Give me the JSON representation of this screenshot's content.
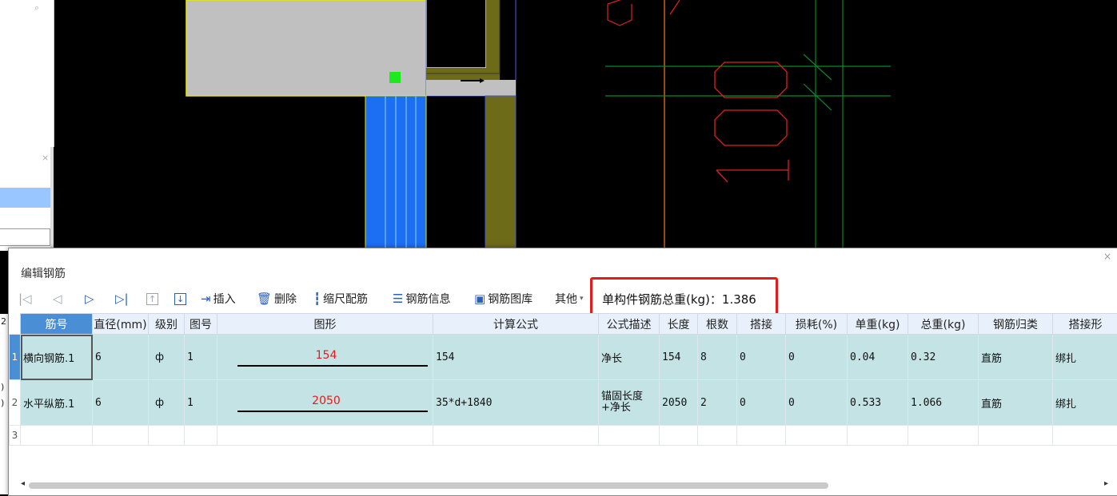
{
  "side": {
    "rowmark_1": "2",
    "rowmark_2": ")",
    "rowmark_3": ")"
  },
  "dialog": {
    "title": "编辑钢筋",
    "close": "×"
  },
  "toolbar": {
    "first_icon": "|◁",
    "prev_icon": "◁",
    "next_icon": "▷",
    "last_icon": "▷|",
    "up_icon": "↑",
    "down_icon": "↓",
    "insert": "插入",
    "delete": "删除",
    "scale_rebar": "缩尺配筋",
    "rebar_info": "钢筋信息",
    "rebar_library": "钢筋图库",
    "other": "其他",
    "total_weight": "单构件钢筋总重(kg)：1.386"
  },
  "table": {
    "headers": [
      "筋号",
      "直径(mm)",
      "级别",
      "图号",
      "图形",
      "计算公式",
      "公式描述",
      "长度",
      "根数",
      "搭接",
      "损耗(%)",
      "单重(kg)",
      "总重(kg)",
      "钢筋归类",
      "搭接形"
    ],
    "rows": [
      {
        "row_no": "1",
        "name": "横向钢筋.1",
        "diameter": "6",
        "grade": "ф",
        "fig_no": "1",
        "shape_value": "154",
        "formula": "154",
        "formula_desc": "净长",
        "length": "154",
        "count": "8",
        "lap": "0",
        "loss": "0",
        "unit_weight": "0.04",
        "total_weight": "0.32",
        "category": "直筋",
        "lap_type": "绑扎"
      },
      {
        "row_no": "2",
        "name": "水平纵筋.1",
        "diameter": "6",
        "grade": "ф",
        "fig_no": "1",
        "shape_value": "2050",
        "formula": "35*d+1840",
        "formula_desc": "锚固长度+净长",
        "length": "2050",
        "count": "2",
        "lap": "0",
        "loss": "0",
        "unit_weight": "0.533",
        "total_weight": "1.066",
        "category": "直筋",
        "lap_type": "绑扎"
      }
    ],
    "empty_row_no": "3"
  },
  "colors": {
    "cad_background": "#000000",
    "highlight_border": "#e21b1b",
    "row_fill": "#c4e3e5",
    "header_selected": "#4a8fd6"
  }
}
